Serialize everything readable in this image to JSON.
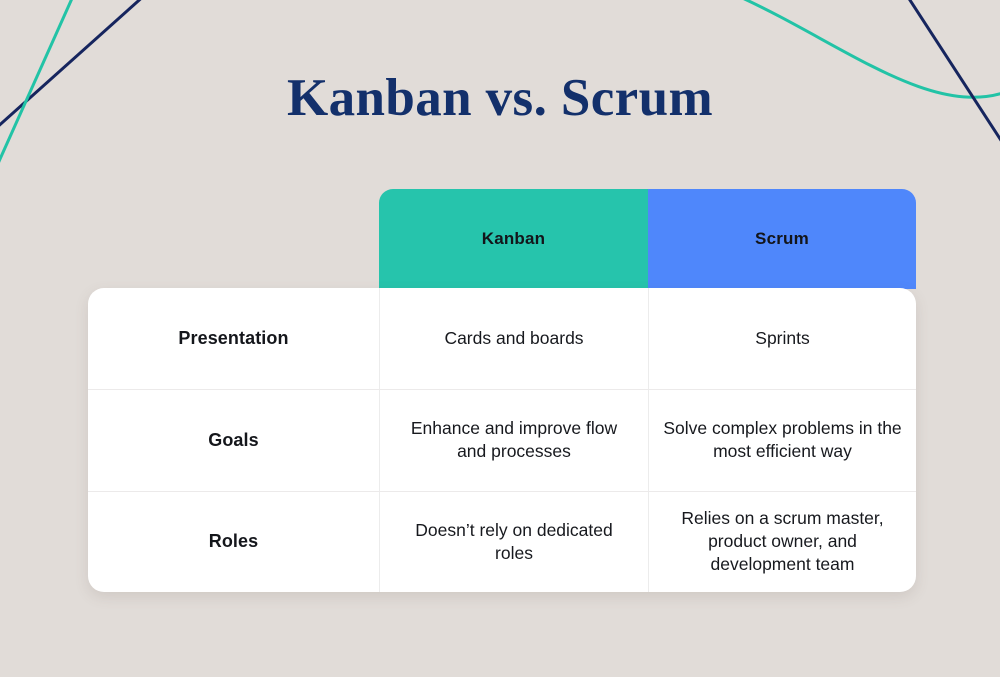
{
  "page": {
    "title": "Kanban vs. Scrum",
    "background_color": "#e1dcd8",
    "title_color": "#13306b"
  },
  "decorations": {
    "navy_color": "#16255e",
    "teal_color": "#22c3a6",
    "lines": [
      {
        "name": "navy-line-top-left",
        "color": "#16255e"
      },
      {
        "name": "teal-line-top-left",
        "color": "#22c3a6"
      },
      {
        "name": "teal-curve-top-right",
        "color": "#22c3a6"
      },
      {
        "name": "navy-line-top-right",
        "color": "#16255e"
      }
    ]
  },
  "table": {
    "columns": [
      {
        "key": "label",
        "label": "",
        "color": ""
      },
      {
        "key": "kanban",
        "label": "Kanban",
        "color": "#26c4ac"
      },
      {
        "key": "scrum",
        "label": "Scrum",
        "color": "#4f87fb"
      }
    ],
    "rows": [
      {
        "label": "Presentation",
        "kanban": "Cards and boards",
        "scrum": "Sprints"
      },
      {
        "label": "Goals",
        "kanban": "Enhance and improve flow and processes",
        "scrum": "Solve complex problems in the most efficient way"
      },
      {
        "label": "Roles",
        "kanban": "Doesn’t rely on dedicated roles",
        "scrum": "Relies on a scrum master, product owner, and development team"
      }
    ]
  }
}
